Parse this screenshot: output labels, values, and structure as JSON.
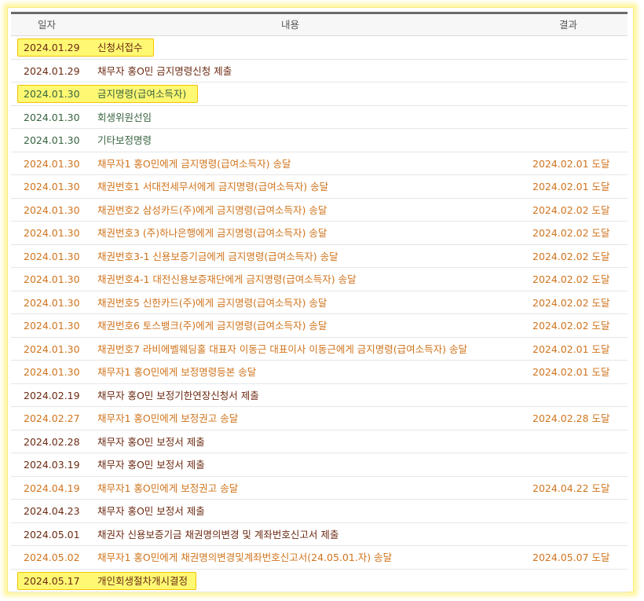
{
  "header": {
    "date": "일자",
    "content": "내용",
    "result": "결과"
  },
  "rows": [
    {
      "date": "2024.01.29",
      "content": "신청서접수",
      "result": ""
    },
    {
      "date": "2024.01.29",
      "content": "채무자 홍O민 금지명령신청 제출",
      "result": ""
    },
    {
      "date": "2024.01.30",
      "content": "금지명령(급여소득자)",
      "result": ""
    },
    {
      "date": "2024.01.30",
      "content": "회생위원선임",
      "result": ""
    },
    {
      "date": "2024.01.30",
      "content": "기타보정명령",
      "result": ""
    },
    {
      "date": "2024.01.30",
      "content": "채무자1 홍O민에게 금지명령(급여소득자) 송달",
      "result": "2024.02.01 도달"
    },
    {
      "date": "2024.01.30",
      "content": "채권번호1 서대전세무서에게 금지명령(급여소득자) 송달",
      "result": "2024.02.01 도달"
    },
    {
      "date": "2024.01.30",
      "content": "채권번호2 삼성카드(주)에게 금지명령(급여소득자) 송달",
      "result": "2024.02.02 도달"
    },
    {
      "date": "2024.01.30",
      "content": "채권번호3 (주)하나은행에게 금지명령(급여소득자) 송달",
      "result": "2024.02.02 도달"
    },
    {
      "date": "2024.01.30",
      "content": "채권번호3-1 신용보증기금에게 금지명령(급여소득자) 송달",
      "result": "2024.02.02 도달"
    },
    {
      "date": "2024.01.30",
      "content": "채권번호4-1 대전신용보증재단에게 금지명령(급여소득자) 송달",
      "result": "2024.02.02 도달"
    },
    {
      "date": "2024.01.30",
      "content": "채권번호5 신한카드(주)에게 금지명령(급여소득자) 송달",
      "result": "2024.02.02 도달"
    },
    {
      "date": "2024.01.30",
      "content": "채권번호6 토스뱅크(주)에게 금지명령(급여소득자) 송달",
      "result": "2024.02.02 도달"
    },
    {
      "date": "2024.01.30",
      "content": "채권번호7 라비에벨웨딩홀 대표자 이동근 대표이사 이동근에게 금지명령(급여소득자) 송달",
      "result": "2024.02.01 도달"
    },
    {
      "date": "2024.01.30",
      "content": "채무자1 홍O민에게 보정명령등본 송달",
      "result": "2024.02.01 도달"
    },
    {
      "date": "2024.02.19",
      "content": "채무자 홍O민 보정기한연장신청서 제출",
      "result": ""
    },
    {
      "date": "2024.02.27",
      "content": "채무자1 홍O민에게 보정권고 송달",
      "result": "2024.02.28 도달"
    },
    {
      "date": "2024.02.28",
      "content": "채무자 홍O민 보정서 제출",
      "result": ""
    },
    {
      "date": "2024.03.19",
      "content": "채무자 홍O민 보정서 제출",
      "result": ""
    },
    {
      "date": "2024.04.19",
      "content": "채무자1 홍O민에게 보정권고 송달",
      "result": "2024.04.22 도달"
    },
    {
      "date": "2024.04.23",
      "content": "채무자 홍O민 보정서 제출",
      "result": ""
    },
    {
      "date": "2024.05.01",
      "content": "채권자 신용보증기금 채권명의변경 및 계좌번호신고서 제출",
      "result": ""
    },
    {
      "date": "2024.05.02",
      "content": "채무자1 홍O민에게 채권명의변경및계좌번호신고서(24.05.01.자) 송달",
      "result": "2024.05.07 도달"
    },
    {
      "date": "2024.05.17",
      "content": "개인회생절차개시결정",
      "result": ""
    }
  ],
  "colors": {
    "brown": "#6b2a12",
    "green": "#37633f",
    "orange": "#d0741d",
    "highlight": "#fff873"
  }
}
